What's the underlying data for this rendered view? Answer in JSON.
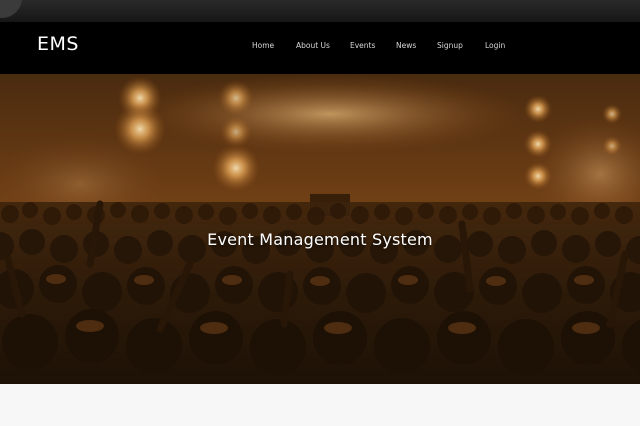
{
  "brand": {
    "name": "EMS"
  },
  "nav": {
    "items": [
      {
        "label": "Home"
      },
      {
        "label": "About Us"
      },
      {
        "label": "Events"
      },
      {
        "label": "News"
      },
      {
        "label": "Signup"
      },
      {
        "label": "Login"
      }
    ]
  },
  "hero": {
    "title": "Event Management System"
  },
  "colors": {
    "navbar_bg": "#000000",
    "hero_tint": "#c07a2a",
    "page_bg": "#f7f7f7"
  }
}
